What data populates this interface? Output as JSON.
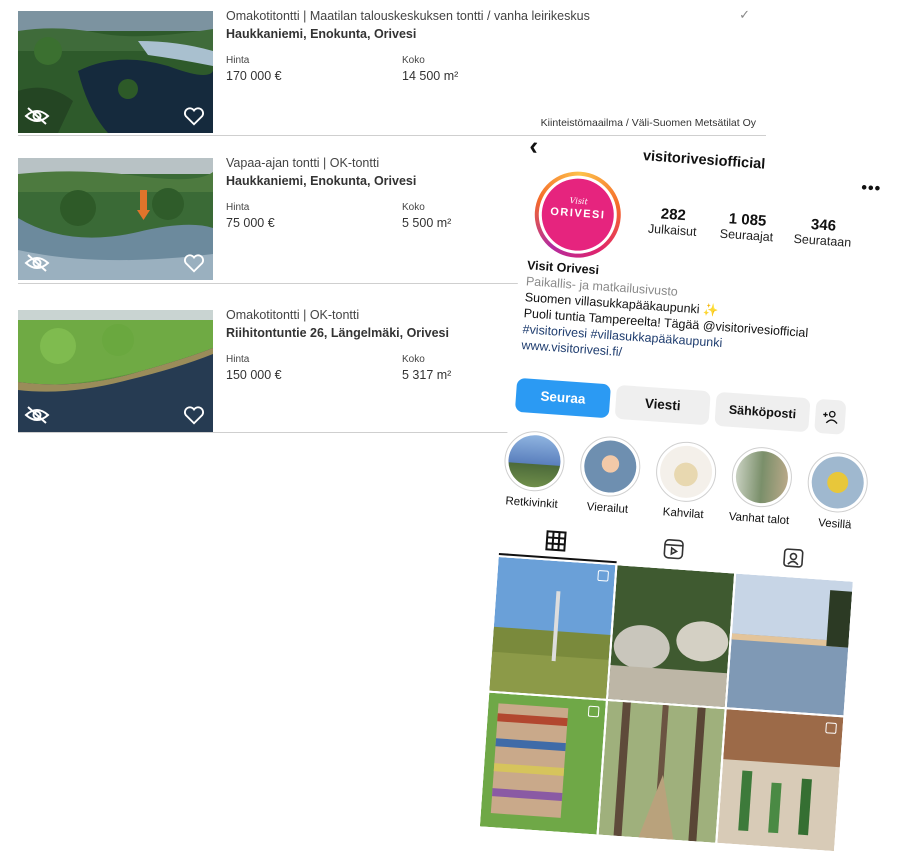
{
  "listings": [
    {
      "type": "Omakotitontti | Maatilan talouskeskuksen tontti / vanha leirikeskus",
      "address": "Haukkaniemi, Enokunta, Orivesi",
      "price_label": "Hinta",
      "price": "170 000 €",
      "size_label": "Koko",
      "size": "14 500 m²",
      "seller": "Kiinteistömaailma / Väli-Suomen Metsätilat Oy",
      "checked": true
    },
    {
      "type": "Vapaa-ajan tontti | OK-tontti",
      "address": "Haukkaniemi, Enokunta, Orivesi",
      "price_label": "Hinta",
      "price": "75 000 €",
      "size_label": "Koko",
      "size": "5 500 m²"
    },
    {
      "type": "Omakotitontti | OK-tontti",
      "address": "Riihitontuntie 26, Längelmäki, Orivesi",
      "price_label": "Hinta",
      "price": "150 000 €",
      "size_label": "Koko",
      "size": "5 317 m²"
    }
  ],
  "instagram": {
    "username": "visitorivesiofficial",
    "avatar_script": "Visit",
    "avatar_brand": "ORIVESI",
    "stats": [
      {
        "value": "282",
        "label": "Julkaisut"
      },
      {
        "value": "1 085",
        "label": "Seuraajat"
      },
      {
        "value": "346",
        "label": "Seurataan"
      }
    ],
    "display_name": "Visit Orivesi",
    "category": "Paikallis- ja matkailusivusto",
    "bio": [
      "Suomen villasukkapääkaupunki ✨",
      "Puoli tuntia Tampereelta! Tägää @visitorivesiofficial",
      "#visitorivesi #villasukkapääkaupunki"
    ],
    "link": "www.visitorivesi.fi/",
    "buttons": {
      "follow": "Seuraa",
      "message": "Viesti",
      "email": "Sähköposti"
    },
    "highlights": [
      "Retkivinkit",
      "Vierailut",
      "Kahvilat",
      "Vanhat talot",
      "Vesillä"
    ],
    "icons": [
      "back-arrow-icon",
      "more-dots-icon",
      "grid-icon",
      "reels-icon",
      "tagged-icon",
      "add-person-icon"
    ],
    "colors": {
      "follow": "#2b9af3",
      "avatar": "#e6247e"
    }
  }
}
